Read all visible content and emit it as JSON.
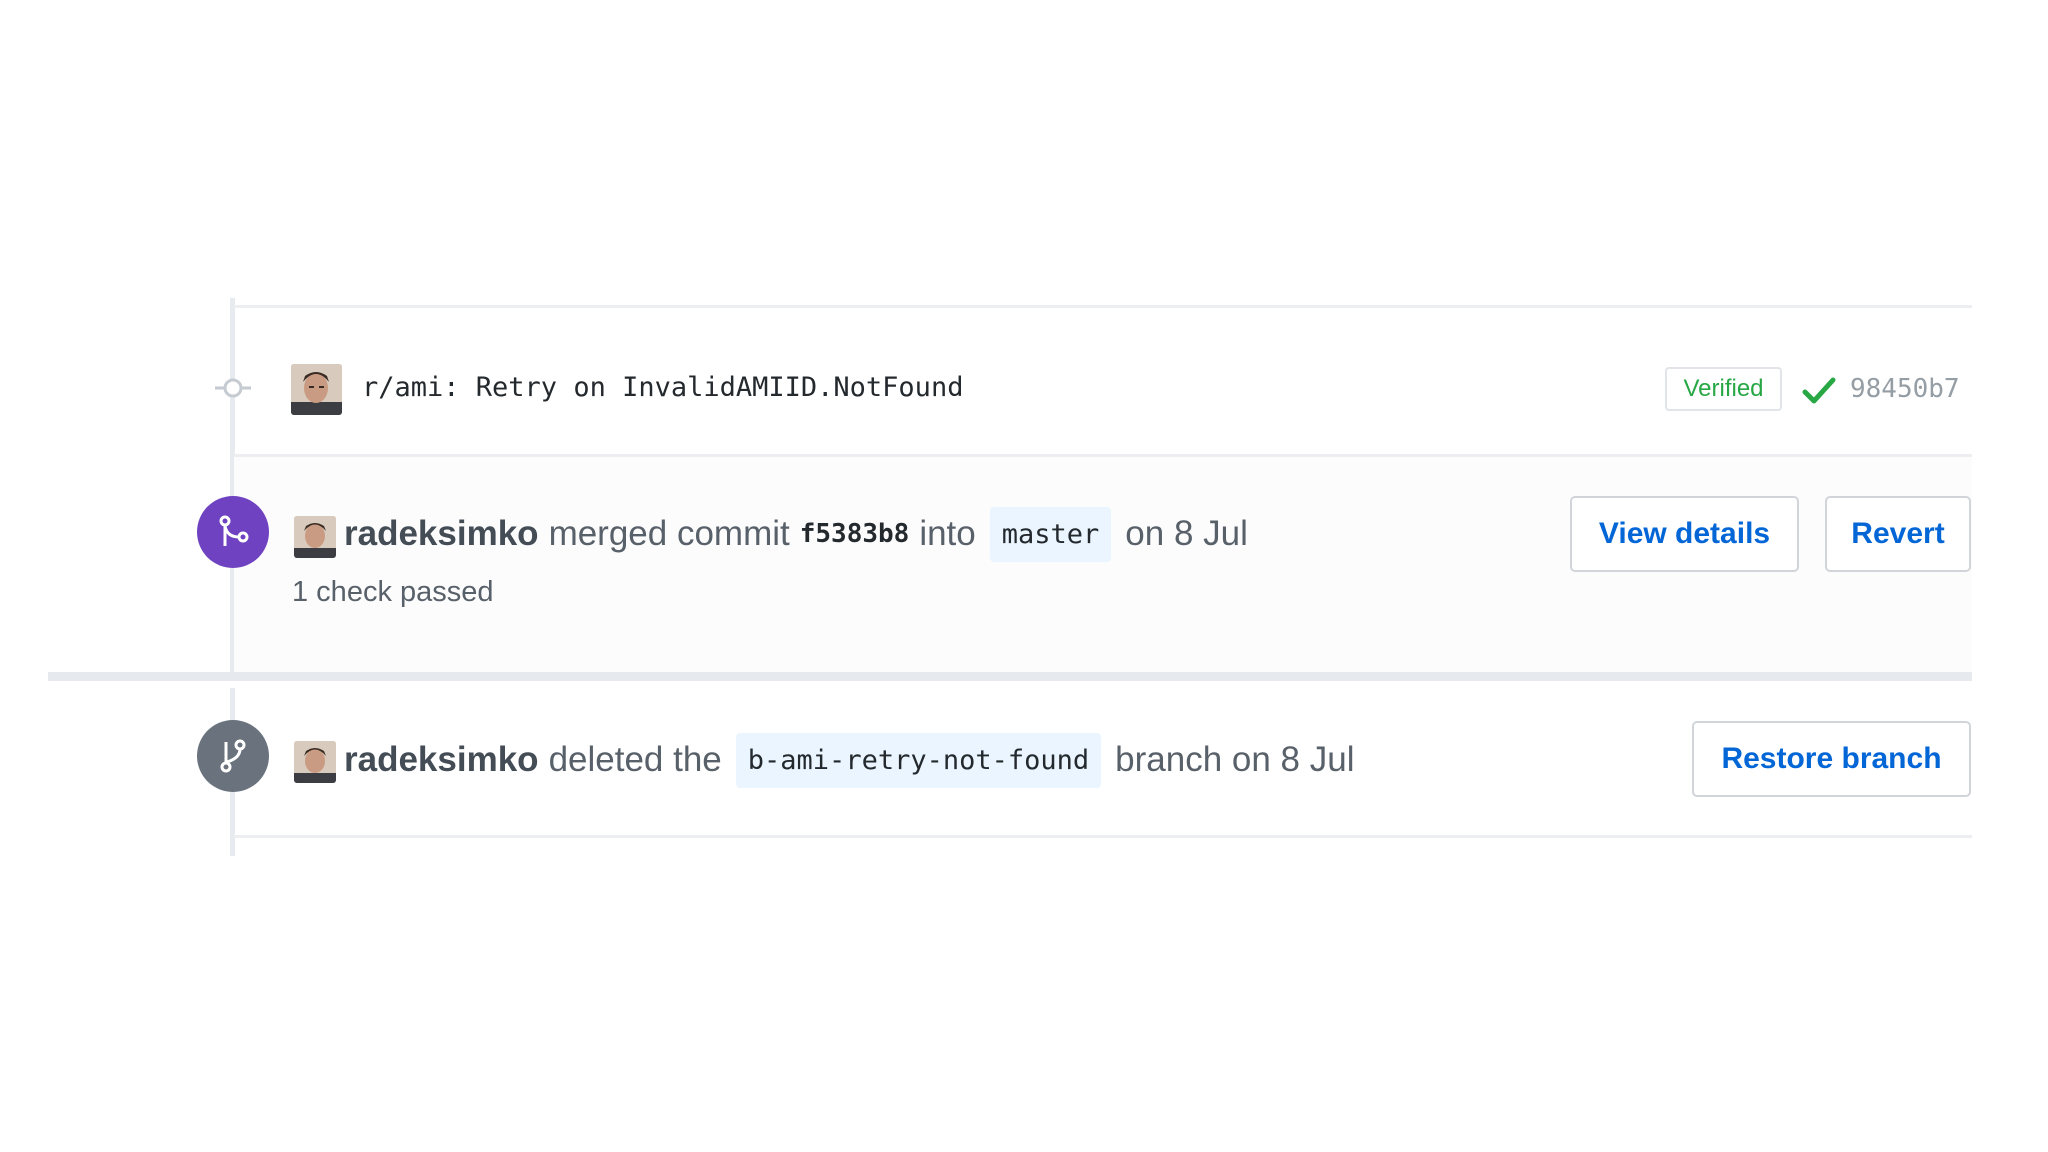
{
  "commit": {
    "message": "r/ami: Retry on InvalidAMIID.NotFound",
    "verified_label": "Verified",
    "sha": "98450b7",
    "status": "passed",
    "status_color": "#28a745"
  },
  "merge_event": {
    "author": "radeksimko",
    "action": "merged commit",
    "commit_sha": "f5383b8",
    "into_word": "into",
    "branch": "master",
    "date": "on 8 Jul",
    "checks": "1 check passed",
    "view_details_label": "View details",
    "revert_label": "Revert",
    "badge_color": "#6f42c1"
  },
  "delete_event": {
    "author": "radeksimko",
    "action": "deleted the",
    "branch": "b-ami-retry-not-found",
    "suffix": "branch on 8 Jul",
    "restore_label": "Restore branch",
    "badge_color": "#6a737d"
  },
  "icons": {
    "commit": "git-commit-icon",
    "merge": "git-merge-icon",
    "branch": "git-branch-icon",
    "check": "check-icon"
  },
  "colors": {
    "link": "#0366d6",
    "text_muted": "#586069"
  }
}
